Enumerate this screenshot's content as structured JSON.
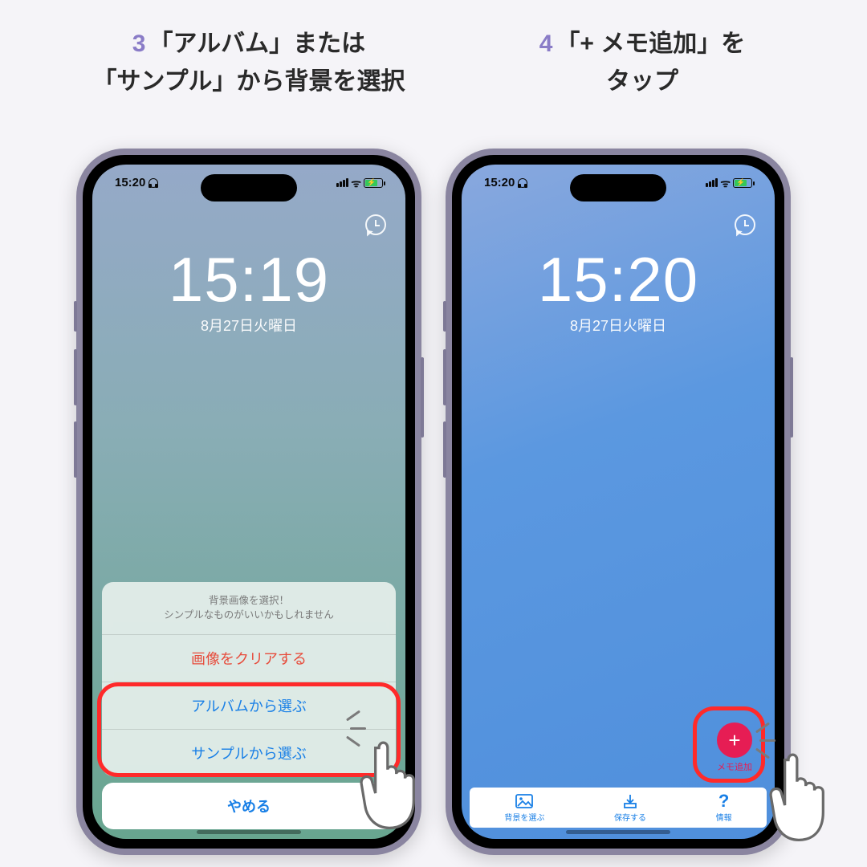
{
  "steps": {
    "left": {
      "num": "3",
      "text": "「アルバム」または\n「サンプル」から背景を選択"
    },
    "right": {
      "num": "4",
      "text": "「+ メモ追加」を\nタップ"
    }
  },
  "status": {
    "time_left": "15:20",
    "time_right": "15:20",
    "wifi_label": ""
  },
  "clock": {
    "left": {
      "time": "15:19",
      "date": "8月27日火曜日"
    },
    "right": {
      "time": "15:20",
      "date": "8月27日火曜日"
    }
  },
  "sheet": {
    "header_line1": "背景画像を選択！",
    "header_line2": "シンプルなものがいいかもしれません",
    "clear": "画像をクリアする",
    "album": "アルバムから選ぶ",
    "sample": "サンプルから選ぶ",
    "cancel": "やめる"
  },
  "toolbar": {
    "bg": "背景を選ぶ",
    "save": "保存する",
    "info": "情報"
  },
  "fab": {
    "plus": "+",
    "label": "メモ追加"
  }
}
